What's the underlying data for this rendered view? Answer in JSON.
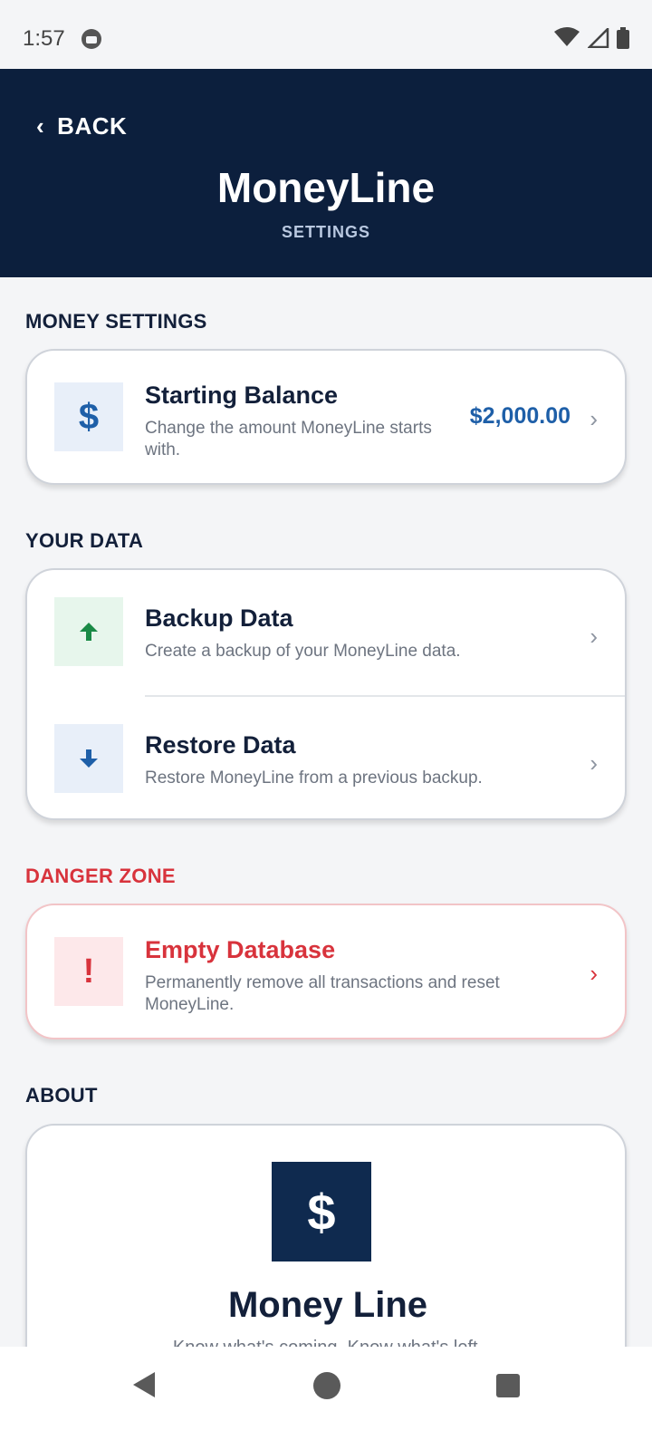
{
  "status_bar": {
    "time": "1:57"
  },
  "header": {
    "back_label": "BACK",
    "title": "MoneyLine",
    "subtitle": "SETTINGS"
  },
  "money_settings": {
    "label": "MONEY SETTINGS",
    "starting_balance": {
      "title": "Starting Balance",
      "description": "Change the amount MoneyLine starts with.",
      "value": "$2,000.00",
      "icon": "$"
    }
  },
  "your_data": {
    "label": "YOUR DATA",
    "backup": {
      "title": "Backup Data",
      "description": "Create a backup of your MoneyLine data."
    },
    "restore": {
      "title": "Restore Data",
      "description": "Restore MoneyLine from a previous backup."
    }
  },
  "danger_zone": {
    "label": "DANGER ZONE",
    "empty_db": {
      "title": "Empty Database",
      "description": "Permanently remove all transactions and reset MoneyLine.",
      "icon": "!"
    }
  },
  "about": {
    "label": "ABOUT",
    "logo_symbol": "$",
    "app_name": "Money Line",
    "tagline": "Know what's coming. Know what's left."
  },
  "colors": {
    "header_bg": "#0c1f3d",
    "accent_blue": "#1e5fa8",
    "danger_red": "#d8333c",
    "success_green": "#1a8a46"
  },
  "chevron": "›"
}
